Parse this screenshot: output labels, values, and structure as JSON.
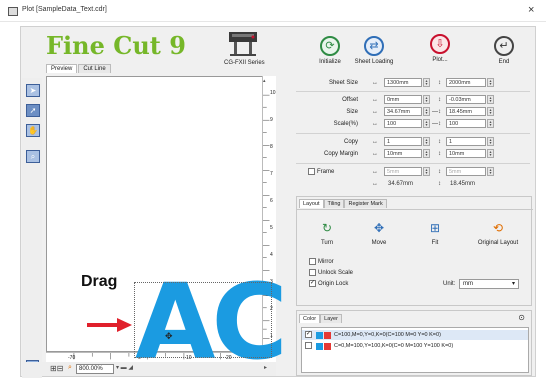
{
  "window": {
    "title": "Plot [SampleData_Text.cdr]",
    "close_glyph": "×"
  },
  "logo": {
    "text": "Fine Cut 9",
    "color": "#76b729"
  },
  "model_label": "CG-FXII Series",
  "view_tabs": [
    {
      "label": "Preview",
      "active": true
    },
    {
      "label": "Cut Line",
      "active": false
    }
  ],
  "toolbar": [
    {
      "label": "Initialize",
      "icon": "refresh-icon",
      "glyph": "⟳"
    },
    {
      "label": "Sheet Loading",
      "icon": "swap-icon",
      "glyph": "⇄"
    },
    {
      "label": "Plot...",
      "icon": "plot-icon",
      "glyph": "⇩"
    },
    {
      "label": "End",
      "icon": "return-icon",
      "glyph": "↵"
    }
  ],
  "properties": {
    "sheet_size": {
      "label": "Sheet Size",
      "width": "1300mm",
      "height": "2000mm"
    },
    "offset": {
      "label": "Offset",
      "x": "0mm",
      "y": "-0.03mm"
    },
    "size": {
      "label": "Size",
      "x": "34.67mm",
      "y": "18.45mm"
    },
    "scale": {
      "label": "Scale(%)",
      "x": "100",
      "y": "100"
    },
    "copy": {
      "label": "Copy",
      "x": "1",
      "y": "1"
    },
    "copy_margin": {
      "label": "Copy Margin",
      "x": "10mm",
      "y": "10mm"
    },
    "frame": {
      "label": "Frame",
      "x": "5mm",
      "y": "5mm",
      "checked": false
    },
    "totals": {
      "x": "34.67mm",
      "y": "18.45mm"
    }
  },
  "lower_tabs": [
    {
      "label": "Layout",
      "active": true
    },
    {
      "label": "Tiling",
      "active": false
    },
    {
      "label": "Register Mark",
      "active": false
    }
  ],
  "layout_buttons": [
    {
      "label": "Turn",
      "glyph": "↻"
    },
    {
      "label": "Move",
      "glyph": "✥"
    },
    {
      "label": "Fit",
      "glyph": "⊞"
    },
    {
      "label": "Original Layout",
      "glyph": "⟲"
    }
  ],
  "options": {
    "mirror": {
      "label": "Mirror",
      "checked": false
    },
    "unlock_scale": {
      "label": "Unlock Scale",
      "checked": false
    },
    "origin_lock": {
      "label": "Origin Lock",
      "checked": true
    },
    "unit_label": "Unit:",
    "unit_value": "mm"
  },
  "color_tabs": [
    {
      "label": "Color",
      "active": true
    },
    {
      "label": "Layer",
      "active": false
    }
  ],
  "color_rows": [
    {
      "text": "C=100,M=0,Y=0,K=0(C=100 M=0 Y=0 K=0)",
      "swatch": "#1b9be1",
      "checked": true
    },
    {
      "text": "C=0,M=100,Y=100,K=0(C=0 M=100 Y=100 K=0)",
      "swatch": "#e53935",
      "checked": false
    }
  ],
  "canvas": {
    "artwork_text": "AC",
    "artwork_color": "#1b9be1",
    "annotation": "Drag",
    "zoom": "800.00%",
    "vruler_labels": [
      "10",
      "9",
      "8",
      "7",
      "6",
      "5",
      "4",
      "3",
      "2",
      "1",
      "0"
    ],
    "hruler_labels": [
      "-70",
      "0",
      "10",
      "20"
    ]
  }
}
